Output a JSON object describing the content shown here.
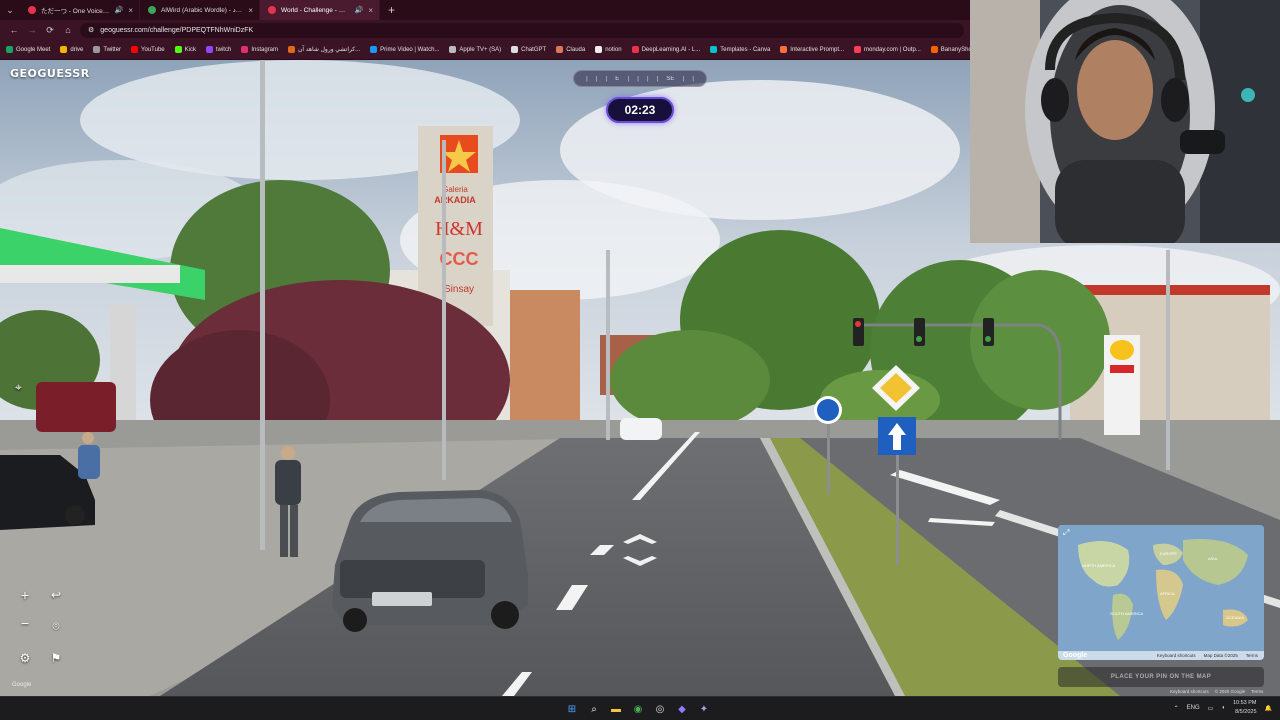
{
  "browser": {
    "tabs": [
      {
        "title": "ただ一つ - One Voice | You",
        "favicon_color": "#e8334a",
        "audio": true,
        "active": false
      },
      {
        "title": "AlWird (Arabic Wordle) - الورد",
        "favicon_color": "#3aa65b",
        "audio": false,
        "active": false
      },
      {
        "title": "World - Challenge - GeoGu",
        "favicon_color": "#e8334a",
        "audio": true,
        "active": true
      }
    ],
    "new_tab_symbol": "+",
    "url": "geoguessr.com/challenge/PDPEQTFNhWniDzFK",
    "bookmarks": [
      {
        "label": "Google Meet",
        "color": "#1aa260"
      },
      {
        "label": "drive",
        "color": "#f4b400"
      },
      {
        "label": "Twitter",
        "color": "#999999"
      },
      {
        "label": "YouTube",
        "color": "#ff0000"
      },
      {
        "label": "Kick",
        "color": "#53fc18"
      },
      {
        "label": "twitch",
        "color": "#9146ff"
      },
      {
        "label": "Instagram",
        "color": "#e1306c"
      },
      {
        "label": "كراتشي ورول شاهد آن...",
        "color": "#e06a1b"
      },
      {
        "label": "Prime Video | Watch...",
        "color": "#1a98ff"
      },
      {
        "label": "Apple TV+ (SA)",
        "color": "#bbbbbb"
      },
      {
        "label": "ChatGPT",
        "color": "#dddddd"
      },
      {
        "label": "Clauda",
        "color": "#d97757"
      },
      {
        "label": "notion",
        "color": "#eeeeee"
      },
      {
        "label": "DeepLearning.AI - L...",
        "color": "#e8334a"
      },
      {
        "label": "Templates - Canva",
        "color": "#00c4cc"
      },
      {
        "label": "Interactive Prompt...",
        "color": "#ff6f3c"
      },
      {
        "label": "monday.com | Outp...",
        "color": "#ff3d57"
      },
      {
        "label": "BananyShop - Etsy",
        "color": "#f56400"
      }
    ]
  },
  "game": {
    "logo": "GEOGUESSR",
    "compass_labels": [
      "E",
      "SE"
    ],
    "timer": "02:23",
    "place_pin_label": "PLACE YOUR PIN ON THE MAP",
    "google_watermark": "Google",
    "map_attribution": [
      "Keyboard shortcuts",
      "Map Data ©2025",
      "Terms"
    ],
    "footer_links": [
      "Keyboard shortcuts",
      "© 2025 Google",
      "Terms"
    ],
    "scene_signs": {
      "tower_line1": "Galeria",
      "tower_line2": "ARKADIA",
      "tower_line3": "H&M",
      "tower_line4": "CCC",
      "tower_line5": "Sinsay"
    },
    "minimap_labels": [
      "NORTH AMERICA",
      "SOUTH AMERICA",
      "AFRICA",
      "EUROPE",
      "ASIA",
      "OCEANIA"
    ]
  },
  "taskbar": {
    "language": "ENG",
    "time": "10:53 PM",
    "date": "8/5/2025"
  },
  "colors": {
    "timer_border": "#6a4bd6",
    "tab_bar": "#2a0b18",
    "toolbar": "#3a1424"
  }
}
